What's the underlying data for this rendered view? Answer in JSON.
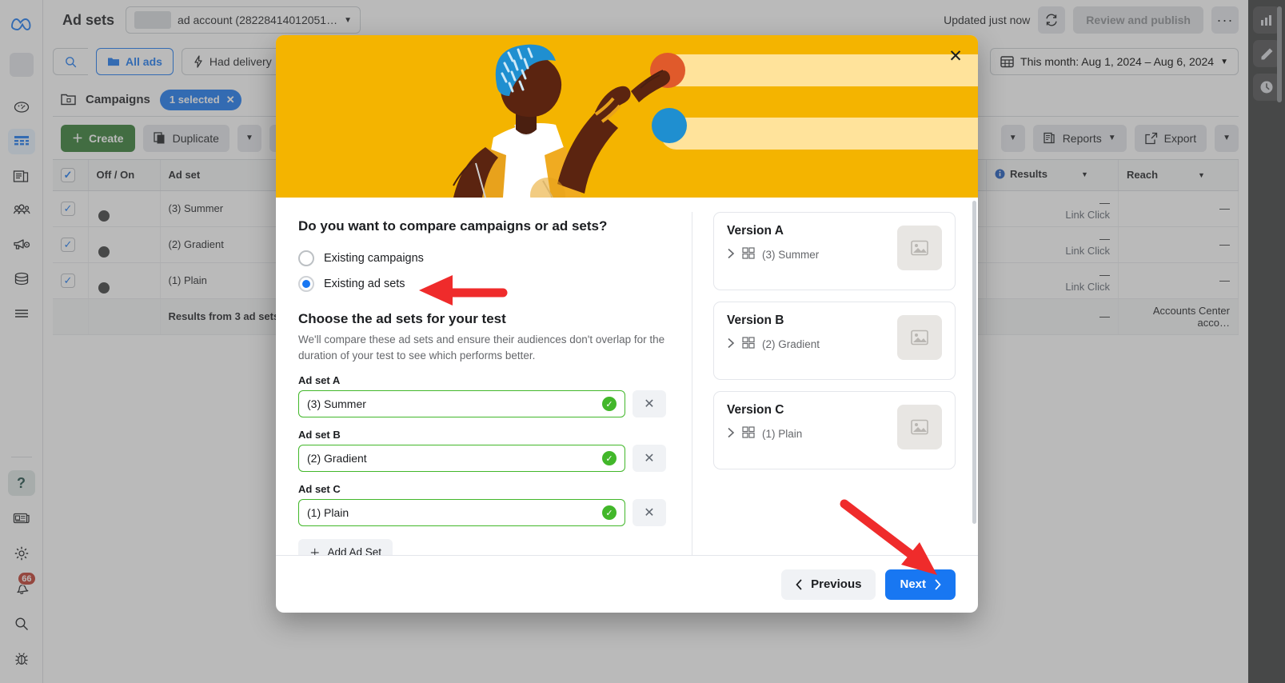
{
  "app": {
    "page_title": "Ad sets",
    "account_picker": "ad account (28228414012051…",
    "updated_label": "Updated just now",
    "review_publish": "Review and publish",
    "more_label": "•••",
    "date_range": "This month: Aug 1, 2024 – Aug 6, 2024"
  },
  "toolbar": {
    "all_ads": "All ads",
    "had_delivery": "Had delivery",
    "reports": "Reports",
    "export": "Export"
  },
  "panel": {
    "title": "Campaigns",
    "selected_chip": "1 selected",
    "create": "Create",
    "duplicate": "Duplicate"
  },
  "table": {
    "columns": [
      "",
      "Off / On",
      "Ad set",
      "Results",
      "Reach"
    ],
    "rows": [
      {
        "name": "(3) Summer",
        "results": "—",
        "results_sub": "Link Click",
        "reach": "—"
      },
      {
        "name": "(2) Gradient",
        "results": "—",
        "results_sub": "Link Click",
        "reach": "—"
      },
      {
        "name": "(1) Plain",
        "results": "—",
        "results_sub": "Link Click",
        "reach": "—"
      }
    ],
    "total_row": {
      "label": "Results from 3 ad sets",
      "results": "—",
      "reach": "Accounts Center acco…"
    }
  },
  "sidebar": {
    "items": [
      {
        "name": "dashboard-icon",
        "label": "Dashboard"
      },
      {
        "name": "table-icon",
        "label": "Ad sets"
      },
      {
        "name": "pages-icon",
        "label": "Pages"
      },
      {
        "name": "audience-icon",
        "label": "Audiences"
      },
      {
        "name": "ads-icon",
        "label": "Ads"
      },
      {
        "name": "billing-icon",
        "label": "Billing"
      },
      {
        "name": "menu-icon",
        "label": "All tools"
      }
    ],
    "bottom": [
      {
        "name": "help-icon",
        "label": "Help"
      },
      {
        "name": "news-icon",
        "label": "News"
      },
      {
        "name": "gear-icon",
        "label": "Settings"
      },
      {
        "name": "bell-icon",
        "label": "Notifications",
        "badge": "66"
      },
      {
        "name": "search-icon",
        "label": "Search"
      },
      {
        "name": "bug-icon",
        "label": "Report bug"
      }
    ]
  },
  "modal": {
    "close_label": "✕",
    "question_title": "Do you want to compare campaigns or ad sets?",
    "options": [
      {
        "label": "Existing campaigns",
        "selected": false
      },
      {
        "label": "Existing ad sets",
        "selected": true
      }
    ],
    "section_title": "Choose the ad sets for your test",
    "section_desc": "We'll compare these ad sets and ensure their audiences don't overlap for the duration of your test to see which performs better.",
    "fields": [
      {
        "label": "Ad set A",
        "value": "(3) Summer",
        "valid": true
      },
      {
        "label": "Ad set B",
        "value": "(2) Gradient",
        "valid": true
      },
      {
        "label": "Ad set C",
        "value": "(1) Plain",
        "valid": true
      }
    ],
    "add_ad_set": "Add Ad Set",
    "versions": [
      {
        "title": "Version A",
        "item": "(3) Summer"
      },
      {
        "title": "Version B",
        "item": "(2) Gradient"
      },
      {
        "title": "Version C",
        "item": "(1) Plain"
      }
    ],
    "previous": "Previous",
    "next": "Next"
  },
  "right_rail": [
    {
      "name": "bar-chart-icon",
      "label": "Insights"
    },
    {
      "name": "pencil-icon",
      "label": "Edit"
    },
    {
      "name": "clock-icon",
      "label": "History"
    }
  ],
  "colors": {
    "accent_blue": "#1877f2",
    "hero_yellow": "#f4b400",
    "valid_green": "#42b72a",
    "create_green": "#317a31",
    "arrow_red": "#ef2b2b",
    "badge_red": "#c0392b"
  }
}
